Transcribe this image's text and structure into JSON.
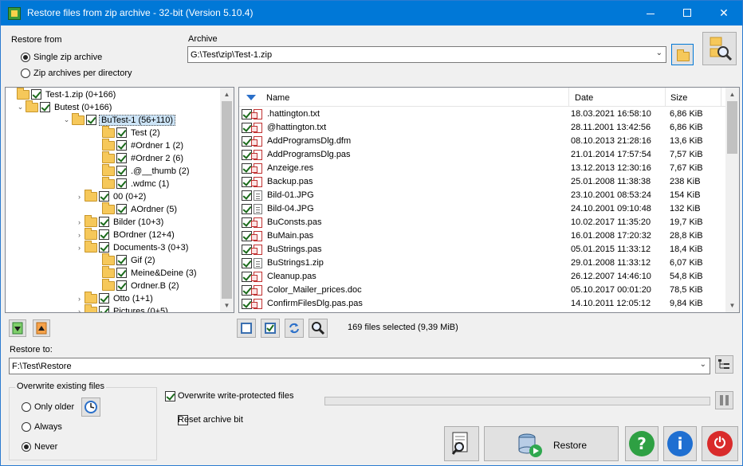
{
  "window": {
    "title": "Restore files from zip archive - 32-bit (Version 5.10.4)",
    "controls": {
      "minimize": "—",
      "maximize": "☐",
      "close": "✕"
    }
  },
  "restore_from": {
    "label": "Restore from",
    "options": [
      {
        "label": "Single zip archive",
        "selected": true
      },
      {
        "label": "Zip archives per directory",
        "selected": false
      }
    ]
  },
  "archive": {
    "label": "Archive",
    "value": "G:\\Test\\zip\\Test-1.zip"
  },
  "tree": {
    "items": [
      {
        "label": "Test-1.zip (0+166)",
        "checked": true,
        "expander": ""
      },
      {
        "label": "Butest (0+166)",
        "checked": true,
        "expander": "⌄"
      },
      {
        "label": "BuTest-1 (56+110)",
        "checked": true,
        "expander": "⌄",
        "selected": true
      },
      {
        "label": "Test (2)",
        "checked": true,
        "expander": ""
      },
      {
        "label": "#Ordner 1 (2)",
        "checked": true,
        "expander": ""
      },
      {
        "label": "#Ordner 2 (6)",
        "checked": true,
        "expander": ""
      },
      {
        "label": ".@__thumb (2)",
        "checked": true,
        "expander": ""
      },
      {
        "label": ".wdmc (1)",
        "checked": true,
        "expander": ""
      },
      {
        "label": "00 (0+2)",
        "checked": true,
        "expander": "›"
      },
      {
        "label": "AOrdner (5)",
        "checked": true,
        "expander": ""
      },
      {
        "label": "Bilder (10+3)",
        "checked": true,
        "expander": "›"
      },
      {
        "label": "BOrdner (12+4)",
        "checked": true,
        "expander": "›"
      },
      {
        "label": "Documents-3 (0+3)",
        "checked": true,
        "expander": "›"
      },
      {
        "label": "Gif (2)",
        "checked": true,
        "expander": ""
      },
      {
        "label": "Meine&Deine (3)",
        "checked": true,
        "expander": ""
      },
      {
        "label": "Ordner.B (2)",
        "checked": true,
        "expander": ""
      },
      {
        "label": "Otto (1+1)",
        "checked": true,
        "expander": "›"
      },
      {
        "label": "Pictures (0+5)",
        "checked": true,
        "expander": "›"
      }
    ]
  },
  "files": {
    "columns": {
      "name": "Name",
      "date": "Date",
      "size": "Size"
    },
    "rows": [
      {
        "name": ".hattington.txt",
        "date": "18.03.2021 16:58:10",
        "size": "6,86 KiB",
        "icon": "red"
      },
      {
        "name": "@hattington.txt",
        "date": "28.11.2001 13:42:56",
        "size": "6,86 KiB",
        "icon": "red"
      },
      {
        "name": "AddProgramsDlg.dfm",
        "date": "08.10.2013 21:28:16",
        "size": "13,6 KiB",
        "icon": "red"
      },
      {
        "name": "AddProgramsDlg.pas",
        "date": "21.01.2014 17:57:54",
        "size": "7,57 KiB",
        "icon": "red"
      },
      {
        "name": "Anzeige.res",
        "date": "13.12.2013 12:30:16",
        "size": "7,67 KiB",
        "icon": "red"
      },
      {
        "name": "Backup.pas",
        "date": "25.01.2008 11:38:38",
        "size": "238 KiB",
        "icon": "red"
      },
      {
        "name": "Bild-01.JPG",
        "date": "23.10.2001 08:53:24",
        "size": "154 KiB",
        "icon": "grey"
      },
      {
        "name": "Bild-04.JPG",
        "date": "24.10.2001 09:10:48",
        "size": "132 KiB",
        "icon": "grey"
      },
      {
        "name": "BuConsts.pas",
        "date": "10.02.2017 11:35:20",
        "size": "19,7 KiB",
        "icon": "red"
      },
      {
        "name": "BuMain.pas",
        "date": "16.01.2008 17:20:32",
        "size": "28,8 KiB",
        "icon": "red"
      },
      {
        "name": "BuStrings.pas",
        "date": "05.01.2015 11:33:12",
        "size": "18,4 KiB",
        "icon": "red"
      },
      {
        "name": "BuStrings1.zip",
        "date": "29.01.2008 11:33:12",
        "size": "6,07 KiB",
        "icon": "grey"
      },
      {
        "name": "Cleanup.pas",
        "date": "26.12.2007 14:46:10",
        "size": "54,8 KiB",
        "icon": "red"
      },
      {
        "name": "Color_Mailer_prices.doc",
        "date": "05.10.2017 00:01:20",
        "size": "78,5 KiB",
        "icon": "red"
      },
      {
        "name": "ConfirmFilesDlg.pas.pas",
        "date": "14.10.2011 12:05:12",
        "size": "9,84 KiB",
        "icon": "red"
      }
    ]
  },
  "selection_status": "169 files selected (9,39 MiB)",
  "restore_to": {
    "label": "Restore to:",
    "value": "F:\\Test\\Restore"
  },
  "overwrite": {
    "title": "Overwrite existing files",
    "options": [
      {
        "label": "Only older",
        "selected": false
      },
      {
        "label": "Always",
        "selected": false
      },
      {
        "label": "Never",
        "selected": true
      }
    ]
  },
  "options": {
    "overwrite_protected": {
      "label": "Overwrite write-protected files",
      "checked": true
    },
    "reset_archive_bit": {
      "label": "Reset archive bit",
      "checked": false
    }
  },
  "progress_percent": 0,
  "buttons": {
    "restore": "Restore",
    "help_glyph": "?",
    "info_glyph": "i",
    "power_glyph": "⏻"
  },
  "colors": {
    "titlebar": "#0078d7",
    "help": "#2ea043",
    "info": "#1f6fd1",
    "exit": "#d92b2b"
  }
}
